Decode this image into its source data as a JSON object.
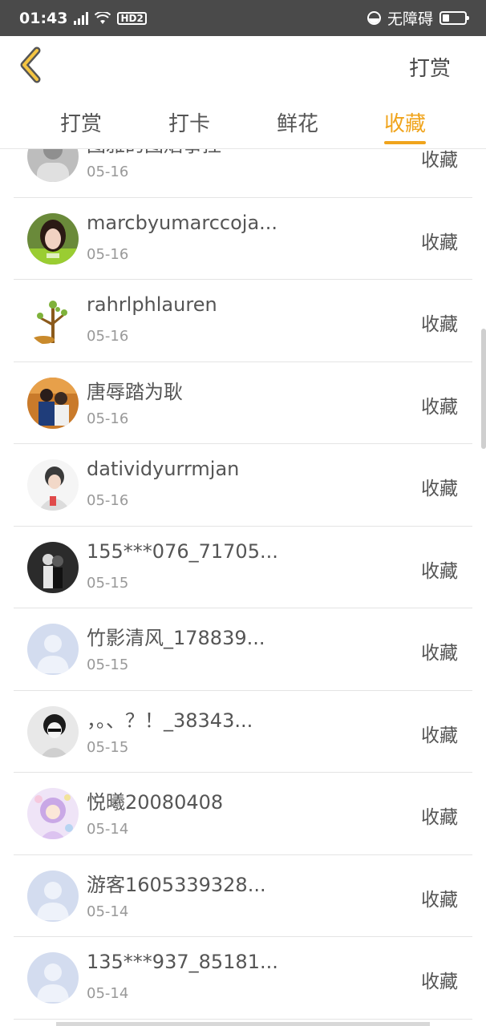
{
  "status": {
    "time": "01:43",
    "network": "4G",
    "hd": "HD2",
    "accessibility": "无障碍"
  },
  "header": {
    "action_label": "打赏"
  },
  "tabs": [
    {
      "label": "打赏",
      "active": false
    },
    {
      "label": "打卡",
      "active": false
    },
    {
      "label": "鲜花",
      "active": false
    },
    {
      "label": "收藏",
      "active": true
    }
  ],
  "colors": {
    "accent": "#f0a41c",
    "statusbar": "#4a4a4a",
    "text": "#555555",
    "muted": "#999999"
  },
  "rows": [
    {
      "name": "图雅的图焰事捏",
      "date": "05-16",
      "action": "收藏",
      "avatar": "photo-gray"
    },
    {
      "name": "marcbyumarccoja...",
      "date": "05-16",
      "action": "收藏",
      "avatar": "photo-girl"
    },
    {
      "name": "rahrlphlauren",
      "date": "05-16",
      "action": "收藏",
      "avatar": "tree-icon"
    },
    {
      "name": "唐辱踏为耿",
      "date": "05-16",
      "action": "收藏",
      "avatar": "photo-couple"
    },
    {
      "name": "datividyurrmjan",
      "date": "05-16",
      "action": "收藏",
      "avatar": "photo-boy"
    },
    {
      "name": "155***076_71705...",
      "date": "05-15",
      "action": "收藏",
      "avatar": "photo-dark"
    },
    {
      "name": "竹影清风_178839...",
      "date": "05-15",
      "action": "收藏",
      "avatar": "default-user"
    },
    {
      "name": "，。、？！_38343...",
      "date": "05-15",
      "action": "收藏",
      "avatar": "photo-bw"
    },
    {
      "name": "悦曦20080408",
      "date": "05-14",
      "action": "收藏",
      "avatar": "photo-anime"
    },
    {
      "name": "游客1605339328...",
      "date": "05-14",
      "action": "收藏",
      "avatar": "default-user"
    },
    {
      "name": "135***937_85181...",
      "date": "05-14",
      "action": "收藏",
      "avatar": "default-user"
    }
  ]
}
